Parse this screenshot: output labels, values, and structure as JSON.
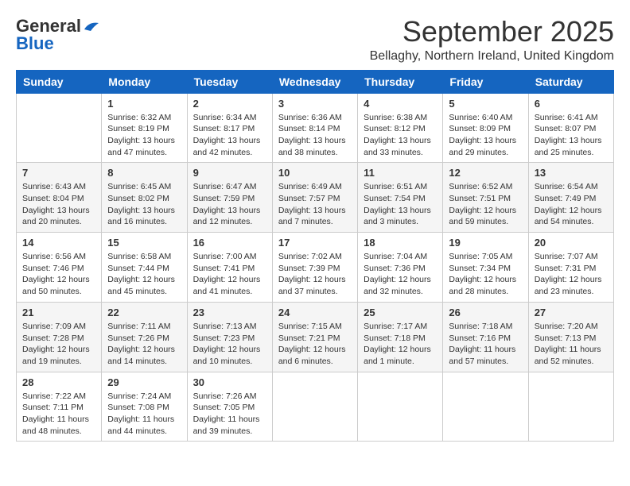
{
  "header": {
    "logo_line1": "General",
    "logo_line2": "Blue",
    "month_title": "September 2025",
    "location": "Bellaghy, Northern Ireland, United Kingdom"
  },
  "weekdays": [
    "Sunday",
    "Monday",
    "Tuesday",
    "Wednesday",
    "Thursday",
    "Friday",
    "Saturday"
  ],
  "weeks": [
    [
      {
        "day": "",
        "info": ""
      },
      {
        "day": "1",
        "info": "Sunrise: 6:32 AM\nSunset: 8:19 PM\nDaylight: 13 hours\nand 47 minutes."
      },
      {
        "day": "2",
        "info": "Sunrise: 6:34 AM\nSunset: 8:17 PM\nDaylight: 13 hours\nand 42 minutes."
      },
      {
        "day": "3",
        "info": "Sunrise: 6:36 AM\nSunset: 8:14 PM\nDaylight: 13 hours\nand 38 minutes."
      },
      {
        "day": "4",
        "info": "Sunrise: 6:38 AM\nSunset: 8:12 PM\nDaylight: 13 hours\nand 33 minutes."
      },
      {
        "day": "5",
        "info": "Sunrise: 6:40 AM\nSunset: 8:09 PM\nDaylight: 13 hours\nand 29 minutes."
      },
      {
        "day": "6",
        "info": "Sunrise: 6:41 AM\nSunset: 8:07 PM\nDaylight: 13 hours\nand 25 minutes."
      }
    ],
    [
      {
        "day": "7",
        "info": "Sunrise: 6:43 AM\nSunset: 8:04 PM\nDaylight: 13 hours\nand 20 minutes."
      },
      {
        "day": "8",
        "info": "Sunrise: 6:45 AM\nSunset: 8:02 PM\nDaylight: 13 hours\nand 16 minutes."
      },
      {
        "day": "9",
        "info": "Sunrise: 6:47 AM\nSunset: 7:59 PM\nDaylight: 13 hours\nand 12 minutes."
      },
      {
        "day": "10",
        "info": "Sunrise: 6:49 AM\nSunset: 7:57 PM\nDaylight: 13 hours\nand 7 minutes."
      },
      {
        "day": "11",
        "info": "Sunrise: 6:51 AM\nSunset: 7:54 PM\nDaylight: 13 hours\nand 3 minutes."
      },
      {
        "day": "12",
        "info": "Sunrise: 6:52 AM\nSunset: 7:51 PM\nDaylight: 12 hours\nand 59 minutes."
      },
      {
        "day": "13",
        "info": "Sunrise: 6:54 AM\nSunset: 7:49 PM\nDaylight: 12 hours\nand 54 minutes."
      }
    ],
    [
      {
        "day": "14",
        "info": "Sunrise: 6:56 AM\nSunset: 7:46 PM\nDaylight: 12 hours\nand 50 minutes."
      },
      {
        "day": "15",
        "info": "Sunrise: 6:58 AM\nSunset: 7:44 PM\nDaylight: 12 hours\nand 45 minutes."
      },
      {
        "day": "16",
        "info": "Sunrise: 7:00 AM\nSunset: 7:41 PM\nDaylight: 12 hours\nand 41 minutes."
      },
      {
        "day": "17",
        "info": "Sunrise: 7:02 AM\nSunset: 7:39 PM\nDaylight: 12 hours\nand 37 minutes."
      },
      {
        "day": "18",
        "info": "Sunrise: 7:04 AM\nSunset: 7:36 PM\nDaylight: 12 hours\nand 32 minutes."
      },
      {
        "day": "19",
        "info": "Sunrise: 7:05 AM\nSunset: 7:34 PM\nDaylight: 12 hours\nand 28 minutes."
      },
      {
        "day": "20",
        "info": "Sunrise: 7:07 AM\nSunset: 7:31 PM\nDaylight: 12 hours\nand 23 minutes."
      }
    ],
    [
      {
        "day": "21",
        "info": "Sunrise: 7:09 AM\nSunset: 7:28 PM\nDaylight: 12 hours\nand 19 minutes."
      },
      {
        "day": "22",
        "info": "Sunrise: 7:11 AM\nSunset: 7:26 PM\nDaylight: 12 hours\nand 14 minutes."
      },
      {
        "day": "23",
        "info": "Sunrise: 7:13 AM\nSunset: 7:23 PM\nDaylight: 12 hours\nand 10 minutes."
      },
      {
        "day": "24",
        "info": "Sunrise: 7:15 AM\nSunset: 7:21 PM\nDaylight: 12 hours\nand 6 minutes."
      },
      {
        "day": "25",
        "info": "Sunrise: 7:17 AM\nSunset: 7:18 PM\nDaylight: 12 hours\nand 1 minute."
      },
      {
        "day": "26",
        "info": "Sunrise: 7:18 AM\nSunset: 7:16 PM\nDaylight: 11 hours\nand 57 minutes."
      },
      {
        "day": "27",
        "info": "Sunrise: 7:20 AM\nSunset: 7:13 PM\nDaylight: 11 hours\nand 52 minutes."
      }
    ],
    [
      {
        "day": "28",
        "info": "Sunrise: 7:22 AM\nSunset: 7:11 PM\nDaylight: 11 hours\nand 48 minutes."
      },
      {
        "day": "29",
        "info": "Sunrise: 7:24 AM\nSunset: 7:08 PM\nDaylight: 11 hours\nand 44 minutes."
      },
      {
        "day": "30",
        "info": "Sunrise: 7:26 AM\nSunset: 7:05 PM\nDaylight: 11 hours\nand 39 minutes."
      },
      {
        "day": "",
        "info": ""
      },
      {
        "day": "",
        "info": ""
      },
      {
        "day": "",
        "info": ""
      },
      {
        "day": "",
        "info": ""
      }
    ]
  ]
}
